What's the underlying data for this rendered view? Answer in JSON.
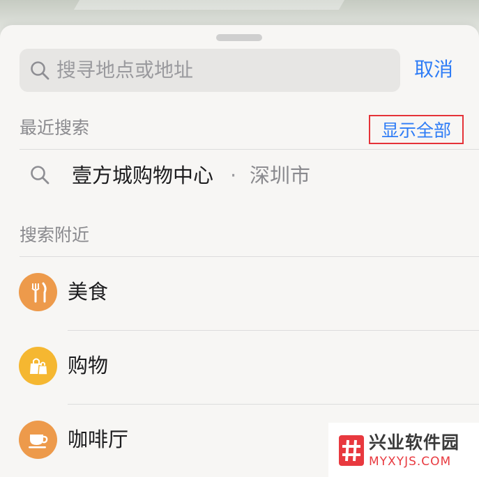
{
  "search": {
    "placeholder": "搜寻地点或地址",
    "cancel_label": "取消"
  },
  "recent": {
    "header": "最近搜索",
    "show_all_label": "显示全部",
    "items": [
      {
        "place": "壹方城购物中心",
        "separator": "·",
        "city": "深圳市"
      }
    ]
  },
  "nearby": {
    "header": "搜索附近",
    "categories": [
      {
        "label": "美食",
        "icon": "fork-knife-icon",
        "color": "#ed9a4b"
      },
      {
        "label": "购物",
        "icon": "shopping-bag-icon",
        "color": "#f5b731"
      },
      {
        "label": "咖啡厅",
        "icon": "coffee-cup-icon",
        "color": "#ed9a4b"
      }
    ]
  },
  "watermark": {
    "title": "兴业软件园",
    "url": "MYXYJS.COM"
  },
  "colors": {
    "accent": "#2e7cf6",
    "highlight_box": "#e53238",
    "watermark_red": "#e8393f"
  }
}
